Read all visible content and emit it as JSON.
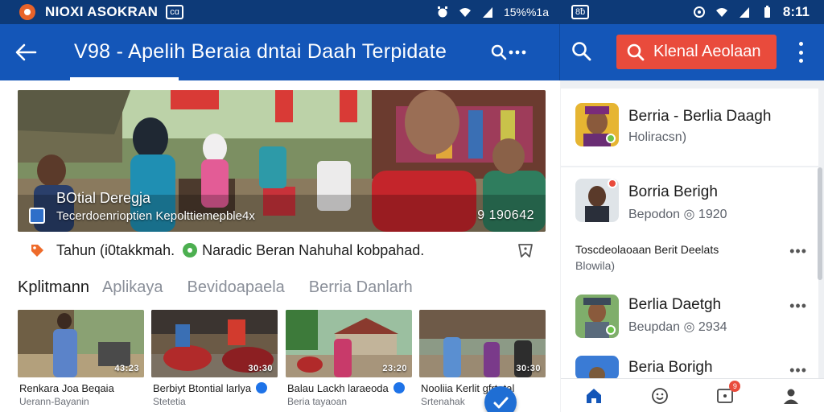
{
  "status_bar": {
    "carrier": "NIOXI ASOKRAN",
    "left_chip": "cɑ",
    "left_indicators": "15%%1a",
    "right_chip": "8ƀ",
    "time": "8:11"
  },
  "app_bar": {
    "title": "V98 - Apelih Beraia dntai Daah  Terpidate",
    "cta_label": "Klenal Aeolaan",
    "colors": {
      "bar": "#1456b8",
      "status": "#0d3a78",
      "cta": "#e94b3c"
    }
  },
  "hero": {
    "title": "BOtial Deregja",
    "subtitle": "Tecerdoenrioptien Kepolttiemepble4x",
    "count": "9  190642"
  },
  "caption": {
    "left": "Tahun (i0takkmah.",
    "right": "Naradic Beran Nahuhal kobpahad."
  },
  "tabs": [
    {
      "label": "Kplitmann"
    },
    {
      "label": "Aplikaya"
    },
    {
      "label": "Bevidoapaela"
    },
    {
      "label": "Berria Danlarh"
    }
  ],
  "thumbnails": [
    {
      "title": "Renkara Joa Beqaia",
      "sub": "Uerann-Bayanin",
      "count": "43:23",
      "verified": false
    },
    {
      "title": "Berbiyt Btontial larlya",
      "sub": "Stetetia",
      "count": "30:30",
      "verified": true
    },
    {
      "title": "Balau Lackh laraeoda",
      "sub": "Beria tayaoan",
      "count": "23:20",
      "verified": true
    },
    {
      "title": "Nooliia Kerlit gfrtatal",
      "sub": "Srtenahak",
      "count": "30:30",
      "verified": false
    }
  ],
  "sidebar": {
    "items": [
      {
        "name": "Berria - Berlia Daagh",
        "meta": "Holiracsn)"
      },
      {
        "name": "Borria Berigh",
        "meta": "Bepodon  ◎ 1920"
      },
      {
        "name": "Toscdeolaoaan  Berit Deelats",
        "meta": "Blowila)"
      },
      {
        "name": "Berlia Daetgh",
        "meta": "Beupdan  ◎ 2934"
      },
      {
        "name": "Beria Borigh",
        "meta": ""
      }
    ],
    "more_label": "•••"
  },
  "bottom_nav": {
    "items": [
      {
        "icon": "home-icon"
      },
      {
        "icon": "emoji-icon"
      },
      {
        "icon": "notifications-icon",
        "badge": "9"
      },
      {
        "icon": "profile-icon"
      }
    ]
  }
}
